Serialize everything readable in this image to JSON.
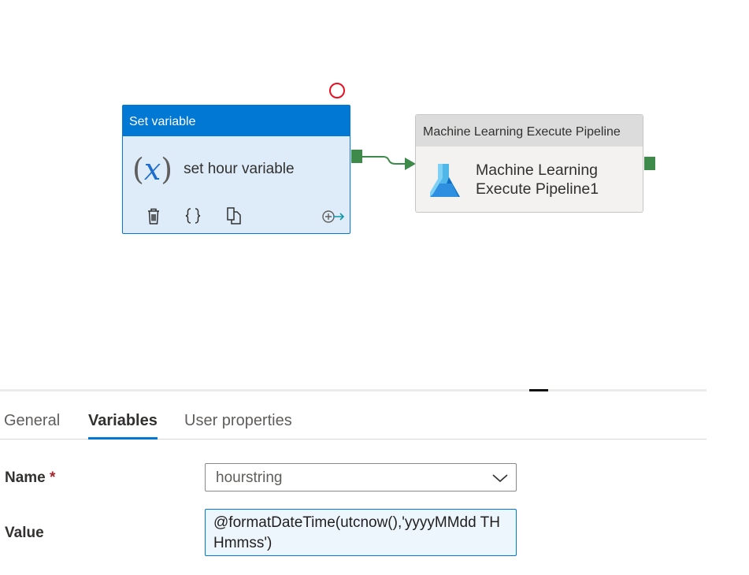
{
  "pipeline": {
    "set_variable": {
      "header": "Set variable",
      "fx_open": "(",
      "fx_x": "x",
      "fx_close": ")",
      "name": "set hour variable",
      "toolbar_icons": [
        "delete-icon",
        "code-braces-icon",
        "copy-icon",
        "add-output-icon"
      ]
    },
    "ml_pipeline": {
      "header": "Machine Learning Execute Pipeline",
      "name_line1": "Machine Learning",
      "name_line2": "Execute Pipeline1",
      "icon": "azure-ml-icon"
    },
    "colors": {
      "accent": "#0078d4",
      "port": "#3d8a4a",
      "error": "#e81123"
    }
  },
  "properties": {
    "tabs": [
      {
        "label": "General",
        "active": false
      },
      {
        "label": "Variables",
        "active": true
      },
      {
        "label": "User properties",
        "active": false
      }
    ],
    "name_label": "Name",
    "required_mark": "*",
    "name_value": "hourstring",
    "value_label": "Value",
    "value_text": "@formatDateTime(utcnow(),'yyyyMMdd THHmmss')"
  }
}
